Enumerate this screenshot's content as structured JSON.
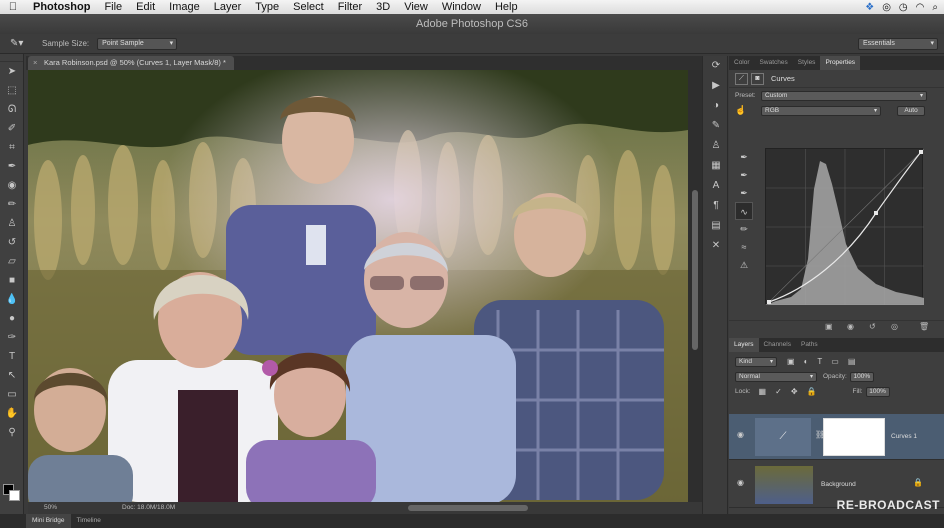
{
  "menubar": {
    "apple_icon": "apple-icon",
    "items": [
      "Photoshop",
      "File",
      "Edit",
      "Image",
      "Layer",
      "Type",
      "Select",
      "Filter",
      "3D",
      "View",
      "Window",
      "Help"
    ]
  },
  "window": {
    "title": "Adobe Photoshop CS6"
  },
  "options": {
    "sample_size_label": "Sample Size:",
    "sample_size_value": "Point Sample",
    "workspace": "Essentials"
  },
  "document": {
    "tab_title": "Kara Robinson.psd @ 50% (Curves 1, Layer Mask/8) *",
    "zoom": "50%",
    "doc_size": "Doc: 18.0M/18.0M"
  },
  "panels": {
    "top_tabs": [
      "Color",
      "Swatches",
      "Styles",
      "Properties"
    ],
    "properties_title": "Curves",
    "preset_label": "Preset:",
    "preset_value": "Custom",
    "channel_value": "RGB",
    "auto_label": "Auto",
    "layer_tabs": [
      "Layers",
      "Channels",
      "Paths"
    ],
    "kind_value": "Kind",
    "blend_mode": "Normal",
    "opacity_label": "Opacity:",
    "opacity_value": "100%",
    "lock_label": "Lock:",
    "fill_label": "Fill:",
    "fill_value": "100%",
    "layers": [
      {
        "name": "Curves 1",
        "selected": true
      },
      {
        "name": "Background",
        "selected": false
      }
    ]
  },
  "bottom_tabs": [
    "Mini Bridge",
    "Timeline"
  ],
  "watermark": "RE-BROADCAST"
}
